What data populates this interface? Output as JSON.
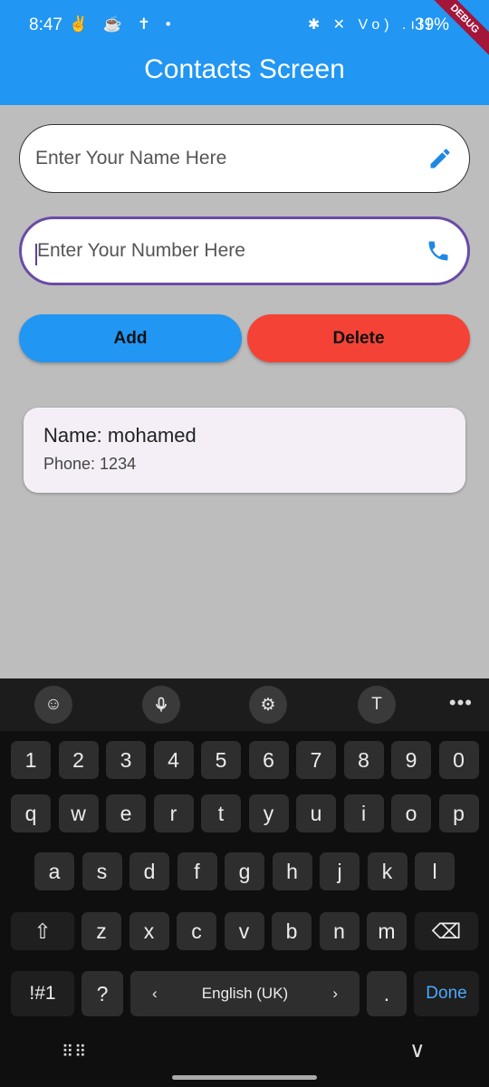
{
  "status_bar": {
    "time": "8:47",
    "left_icons": "✌ ☕ ✝ •",
    "right_icons": "✱ ✕ Vo) .ıll",
    "battery": "39%"
  },
  "debug_banner": "DEBUG",
  "app_bar": {
    "title": "Contacts Screen"
  },
  "form": {
    "name_placeholder": "Enter Your Name Here",
    "name_icon": "pencil-icon",
    "number_placeholder": "Enter Your Number Here",
    "number_icon": "phone-icon"
  },
  "buttons": {
    "add_label": "Add",
    "delete_label": "Delete"
  },
  "contacts": [
    {
      "name": "Name: mohamed",
      "phone": "Phone: 1234"
    }
  ],
  "keyboard": {
    "toolbar": [
      "emoji-icon",
      "microphone-icon",
      "settings-icon",
      "handwriting-icon",
      "more-icon"
    ],
    "toolbar_glyphs": [
      "☺",
      "🎤",
      "⚙",
      "T",
      "•••"
    ],
    "row_numbers": [
      "1",
      "2",
      "3",
      "4",
      "5",
      "6",
      "7",
      "8",
      "9",
      "0"
    ],
    "row_q": [
      "q",
      "w",
      "e",
      "r",
      "t",
      "y",
      "u",
      "i",
      "o",
      "p"
    ],
    "row_a": [
      "a",
      "s",
      "d",
      "f",
      "g",
      "h",
      "j",
      "k",
      "l"
    ],
    "row_z": [
      "z",
      "x",
      "c",
      "v",
      "b",
      "n",
      "m"
    ],
    "shift": "⇧",
    "backspace": "⌫",
    "symbols": "!#1",
    "question": "?",
    "space_left": "‹",
    "space_label": "English (UK)",
    "space_right": "›",
    "period": ".",
    "done": "Done",
    "nav_keyboard": "⠿⠿",
    "nav_down": "∨"
  },
  "colors": {
    "app_bar": "#2196f3",
    "add_button": "#2196f3",
    "delete_button": "#f44336",
    "background": "#bdbdbd",
    "focus_border": "#6a4ba8",
    "icon": "#1e88e5"
  }
}
